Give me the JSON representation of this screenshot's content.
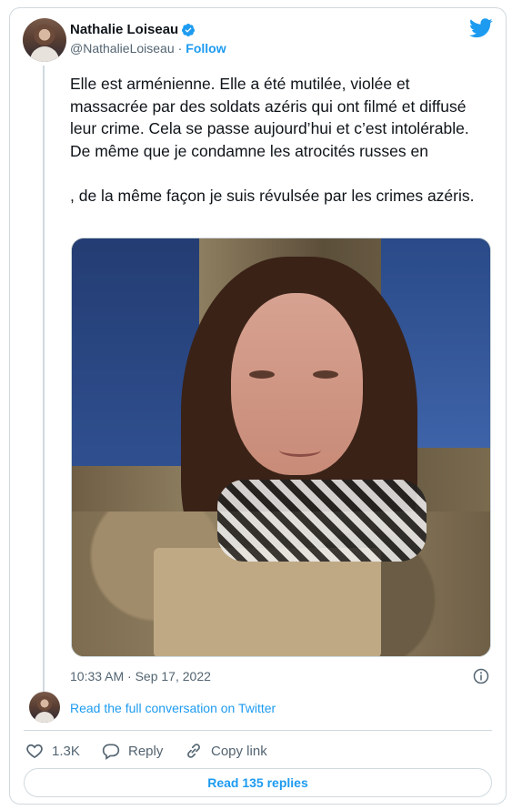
{
  "author": {
    "name": "Nathalie Loiseau",
    "handle": "@NathalieLoiseau",
    "separator": "·",
    "follow_label": "Follow"
  },
  "tweet": {
    "paragraph1": "Elle est arménienne. Elle a été mutilée, violée et massacrée par des soldats azéris qui ont filmé et diffusé leur crime. Cela se passe aujourd’hui et c’est intolérable.",
    "paragraph2_before_flag": "De même que je condamne les atrocités russes en",
    "paragraph2_after_flag": ", de la même façon je suis révulsée par les crimes azéris.",
    "flag_icon": "ukraine-flag-icon",
    "timestamp": "10:33 AM · Sep 17, 2022"
  },
  "conversation_link": "Read the full conversation on Twitter",
  "actions": {
    "like_count": "1.3K",
    "reply_label": "Reply",
    "copy_link_label": "Copy link"
  },
  "read_replies_label": "Read 135 replies",
  "colors": {
    "accent": "#1d9bf0",
    "text": "#0f1419",
    "secondary_text": "#536471",
    "border": "#cfd9de"
  }
}
